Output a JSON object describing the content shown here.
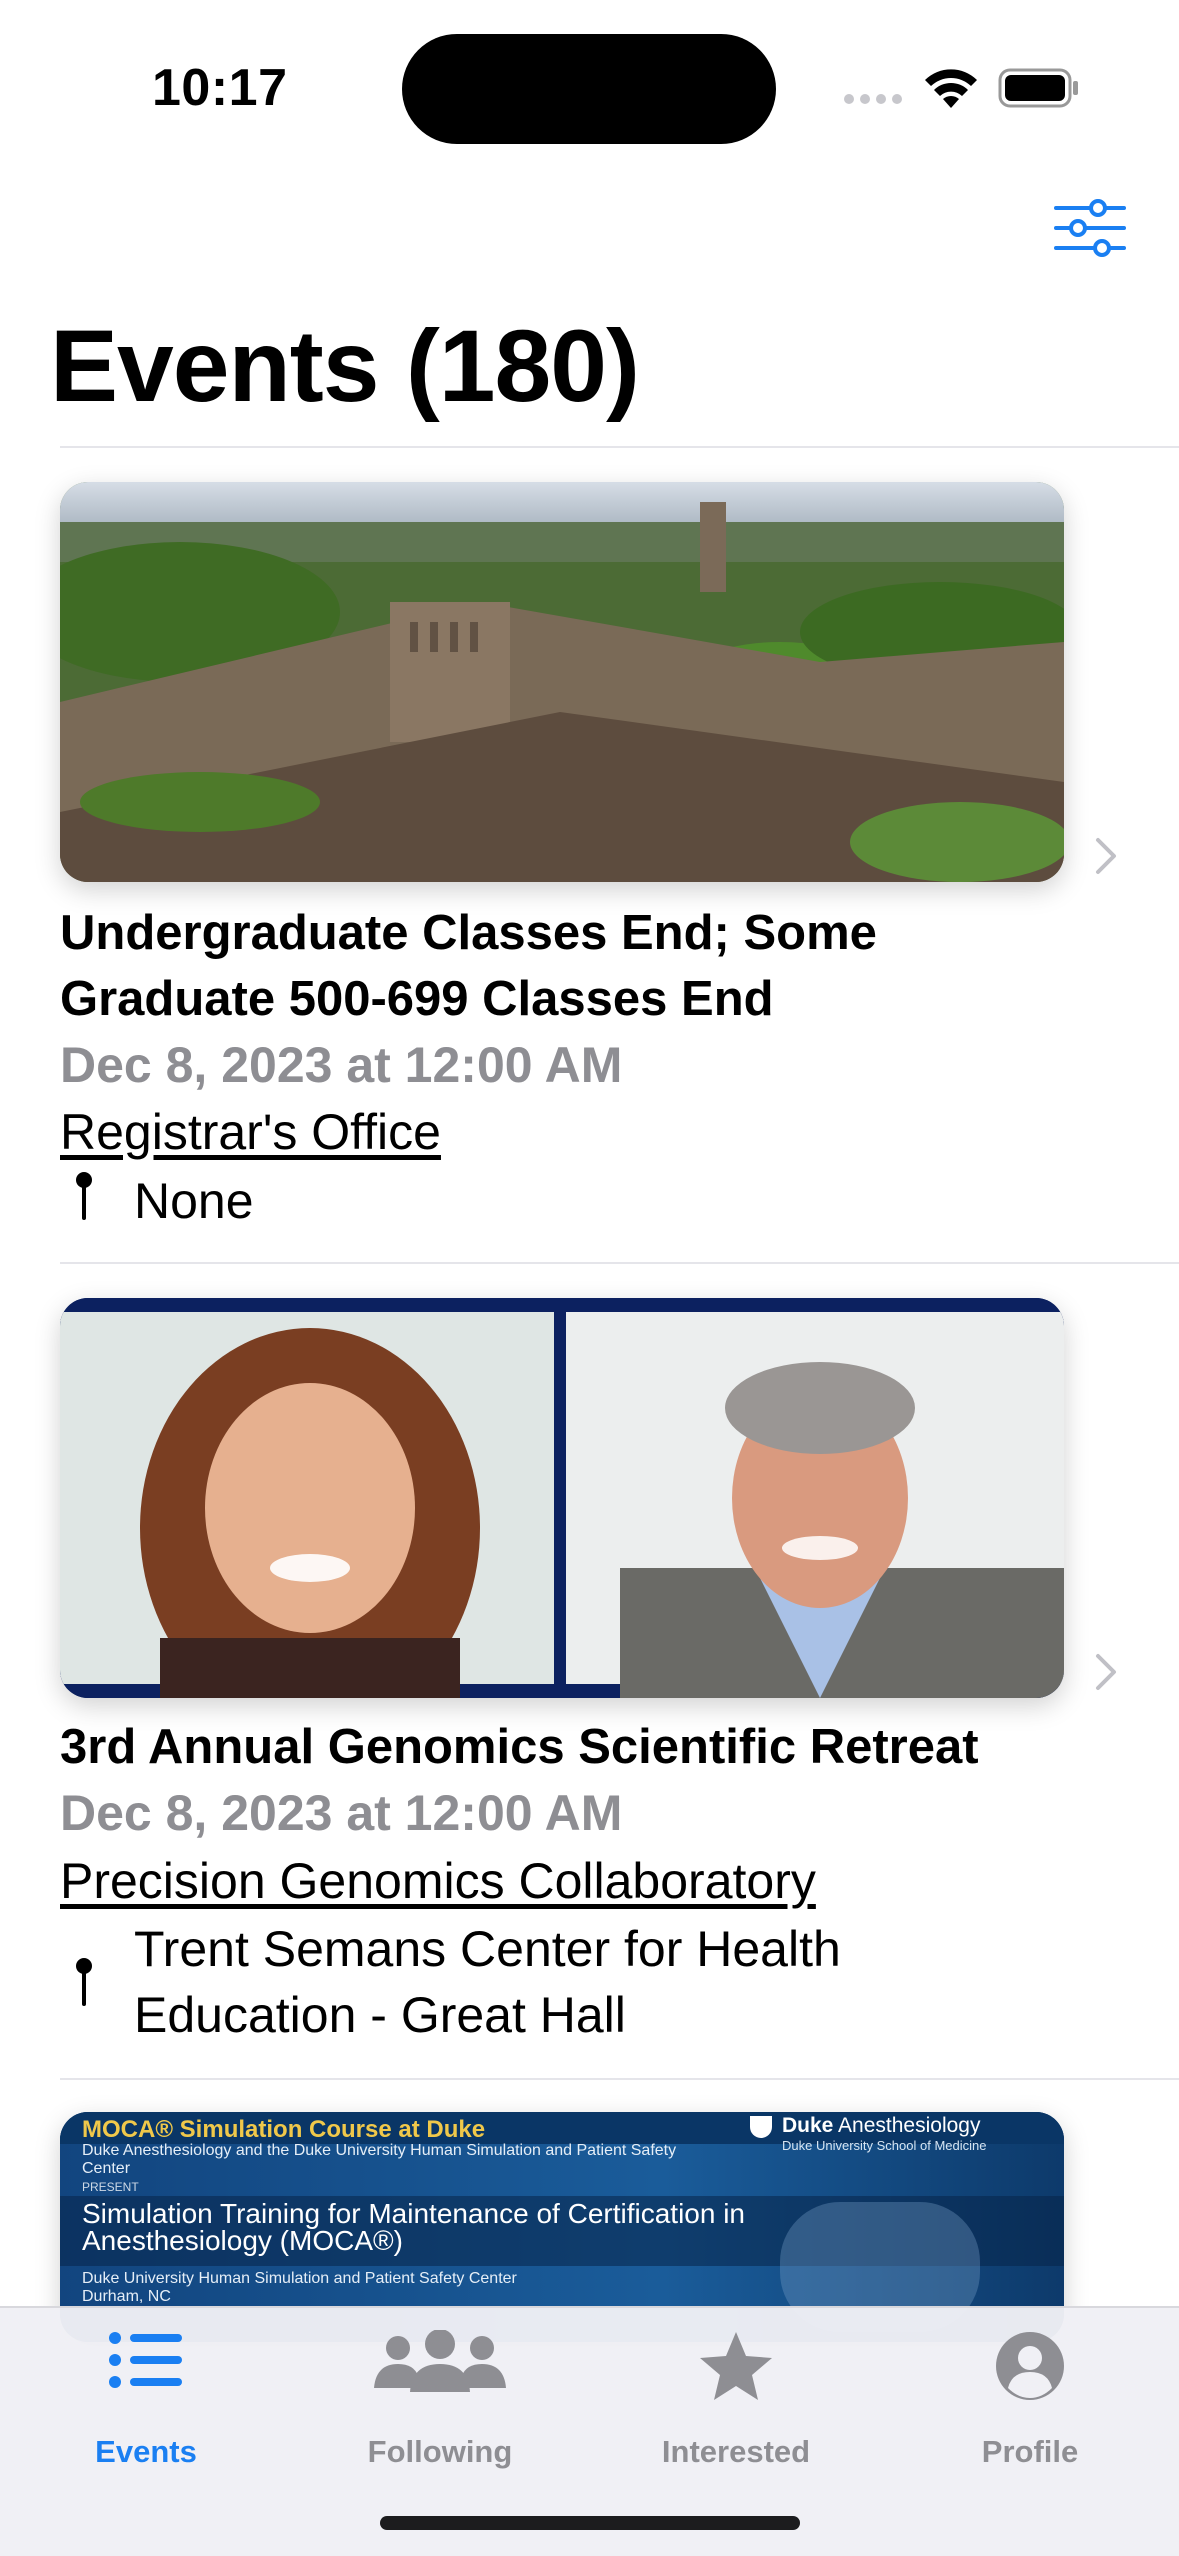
{
  "status_bar": {
    "time": "10:17"
  },
  "header": {
    "title": "Events (180)",
    "filter_icon": "sliders-icon"
  },
  "events": [
    {
      "image": "duke-campus-aerial-photo",
      "title": "Undergraduate Classes End; Some Graduate 500-699 Classes End",
      "date": "Dec 8, 2023 at 12:00 AM",
      "organizer": "Registrar's Office",
      "location": "None"
    },
    {
      "image": "two-speaker-portraits-photo",
      "title": "3rd Annual Genomics Scientific Retreat",
      "date": "Dec 8, 2023 at 12:00 AM",
      "organizer": "Precision Genomics Collaboratory",
      "location": "Trent Semans Center for Health Education - Great Hall"
    },
    {
      "image": "moca-simulation-banner",
      "banner": {
        "heading": "MOCA® Simulation Course at Duke",
        "brand_bold": "Duke",
        "brand_rest": "Anesthesiology",
        "brand_sub": "Duke University School of Medicine",
        "presenters": "Duke Anesthesiology and the Duke University Human Simulation and Patient Safety Center",
        "present": "PRESENT",
        "course": "Simulation Training for Maintenance of Certification in Anesthesiology (MOCA®)",
        "venue": "Duke University Human Simulation and Patient Safety Center",
        "city": "Durham, NC"
      }
    }
  ],
  "tab_bar": {
    "tabs": [
      {
        "label": "Events",
        "icon": "list-icon",
        "active": true
      },
      {
        "label": "Following",
        "icon": "people-icon",
        "active": false
      },
      {
        "label": "Interested",
        "icon": "star-icon",
        "active": false
      },
      {
        "label": "Profile",
        "icon": "person-circle-icon",
        "active": false
      }
    ]
  },
  "colors": {
    "accent": "#1a7ff2",
    "secondary_text": "#8e8e93",
    "divider": "#e5e5ea",
    "tab_inactive": "#8e8e93"
  }
}
